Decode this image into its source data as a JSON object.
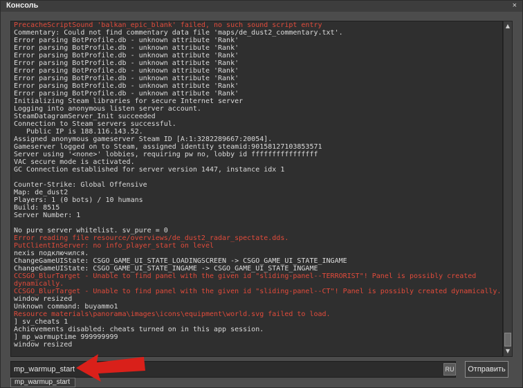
{
  "window": {
    "title": "Консоль",
    "close_label": "×"
  },
  "console": {
    "lines": [
      {
        "text": "PrecacheScriptSound 'balkan_epic_blank' failed, no such sound script entry",
        "type": "error"
      },
      {
        "text": "Commentary: Could not find commentary data file 'maps/de_dust2_commentary.txt'.",
        "type": "normal"
      },
      {
        "text": "Error parsing BotProfile.db - unknown attribute 'Rank'",
        "type": "normal"
      },
      {
        "text": "Error parsing BotProfile.db - unknown attribute 'Rank'",
        "type": "normal"
      },
      {
        "text": "Error parsing BotProfile.db - unknown attribute 'Rank'",
        "type": "normal"
      },
      {
        "text": "Error parsing BotProfile.db - unknown attribute 'Rank'",
        "type": "normal"
      },
      {
        "text": "Error parsing BotProfile.db - unknown attribute 'Rank'",
        "type": "normal"
      },
      {
        "text": "Error parsing BotProfile.db - unknown attribute 'Rank'",
        "type": "normal"
      },
      {
        "text": "Error parsing BotProfile.db - unknown attribute 'Rank'",
        "type": "normal"
      },
      {
        "text": "Error parsing BotProfile.db - unknown attribute 'Rank'",
        "type": "normal"
      },
      {
        "text": "Initializing Steam libraries for secure Internet server",
        "type": "normal"
      },
      {
        "text": "Logging into anonymous listen server account.",
        "type": "normal"
      },
      {
        "text": "SteamDatagramServer_Init succeeded",
        "type": "normal"
      },
      {
        "text": "Connection to Steam servers successful.",
        "type": "normal"
      },
      {
        "text": "   Public IP is 188.116.143.52.",
        "type": "normal"
      },
      {
        "text": "Assigned anonymous gameserver Steam ID [A:1:3282289667:20054].",
        "type": "normal"
      },
      {
        "text": "Gameserver logged on to Steam, assigned identity steamid:90158127103853571",
        "type": "normal"
      },
      {
        "text": "Server using '<none>' lobbies, requiring pw no, lobby id ffffffffffffffff",
        "type": "normal"
      },
      {
        "text": "VAC secure mode is activated.",
        "type": "normal"
      },
      {
        "text": "GC Connection established for server version 1447, instance idx 1",
        "type": "normal"
      },
      {
        "text": "",
        "type": "normal"
      },
      {
        "text": "Counter-Strike: Global Offensive",
        "type": "normal"
      },
      {
        "text": "Map: de_dust2",
        "type": "normal"
      },
      {
        "text": "Players: 1 (0 bots) / 10 humans",
        "type": "normal"
      },
      {
        "text": "Build: 8515",
        "type": "normal"
      },
      {
        "text": "Server Number: 1",
        "type": "normal"
      },
      {
        "text": "",
        "type": "normal"
      },
      {
        "text": "No pure server whitelist. sv_pure = 0",
        "type": "normal"
      },
      {
        "text": "Error reading file resource/overviews/de_dust2_radar_spectate.dds.",
        "type": "error"
      },
      {
        "text": "PutClientInServer: no info_player_start on level",
        "type": "error"
      },
      {
        "text": "nexis подключился.",
        "type": "normal"
      },
      {
        "text": "ChangeGameUIState: CSGO_GAME_UI_STATE_LOADINGSCREEN -> CSGO_GAME_UI_STATE_INGAME",
        "type": "normal"
      },
      {
        "text": "ChangeGameUIState: CSGO_GAME_UI_STATE_INGAME -> CSGO_GAME_UI_STATE_INGAME",
        "type": "normal"
      },
      {
        "text": "CCSGO_BlurTarget - Unable to find panel with the given id \"sliding-panel--TERRORIST\"! Panel is possibly created",
        "type": "error"
      },
      {
        "text": "dynamically.",
        "type": "error"
      },
      {
        "text": "CCSGO_BlurTarget - Unable to find panel with the given id \"sliding-panel--CT\"! Panel is possibly created dynamically.",
        "type": "error"
      },
      {
        "text": "window resized",
        "type": "normal"
      },
      {
        "text": "Unknown command: buyammo1",
        "type": "normal"
      },
      {
        "text": "Resource materials\\panorama\\images\\icons\\equipment\\world.svg failed to load.",
        "type": "error"
      },
      {
        "text": "] sv_cheats 1",
        "type": "normal"
      },
      {
        "text": "Achievements disabled: cheats turned on in this app session.",
        "type": "normal"
      },
      {
        "text": "] mp_warmuptime 999999999",
        "type": "normal"
      },
      {
        "text": "window resized",
        "type": "normal"
      }
    ],
    "colors": {
      "normal": "#dcdcdc",
      "error": "#e24b3b"
    }
  },
  "input": {
    "value": "mp_warmup_start",
    "lang_badge": "RU"
  },
  "submit": {
    "label": "Отправить"
  },
  "suggestion": {
    "label": "mp_warmup_start"
  },
  "annotation": {
    "arrow_color": "#d9201a"
  }
}
